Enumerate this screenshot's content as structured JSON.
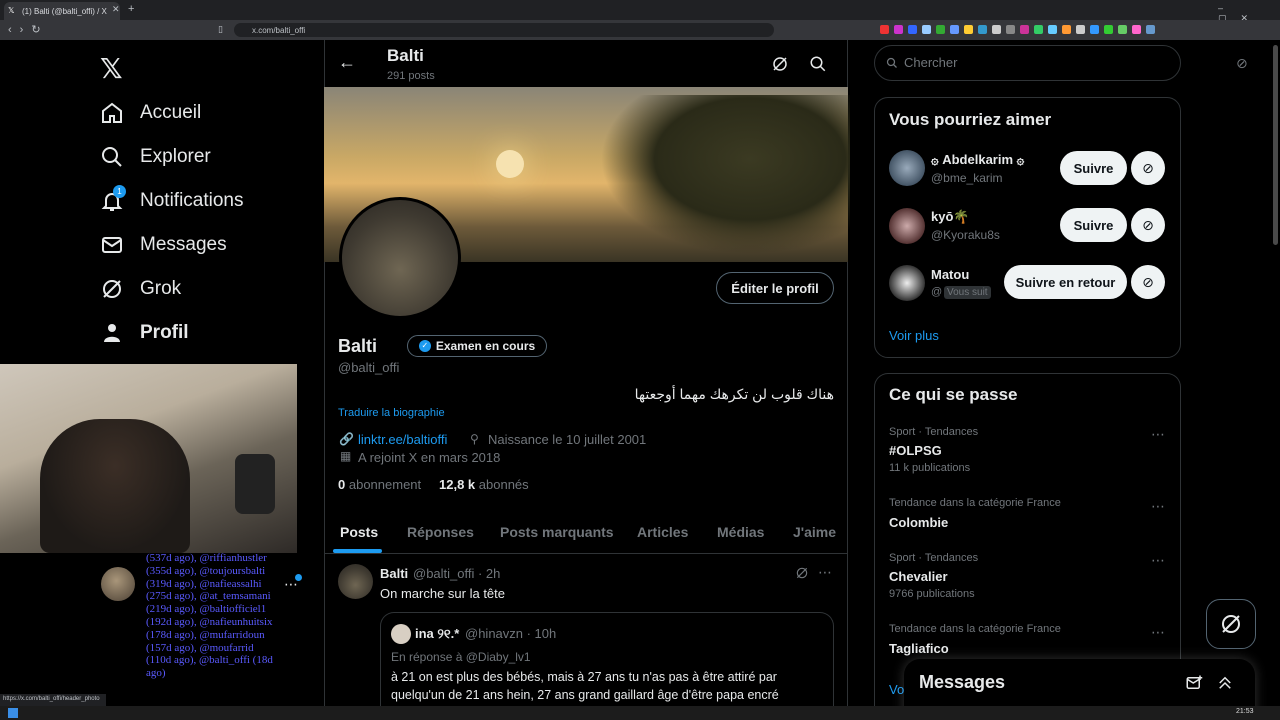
{
  "browser": {
    "tab_title": "(1) Balti (@balti_offi) / X",
    "url": "x.com/balti_offi",
    "status_url": "https://x.com/balti_offi/header_photo"
  },
  "sidebar": {
    "items": [
      {
        "label": "Accueil",
        "icon": "home-icon"
      },
      {
        "label": "Explorer",
        "icon": "search-icon"
      },
      {
        "label": "Notifications",
        "icon": "bell-icon",
        "badge": "1"
      },
      {
        "label": "Messages",
        "icon": "mail-icon"
      },
      {
        "label": "Grok",
        "icon": "grok-icon"
      },
      {
        "label": "Profil",
        "icon": "person-icon"
      }
    ]
  },
  "overlay_text": "(537d ago), @riffianhustler (355d ago), @toujoursbalti (319d ago), @nafieassalhi (275d ago), @at_temsamani (219d ago), @baltiofficiel1 (192d ago), @nafieunhuitsix (178d ago), @mufarridoun (157d ago), @moufarrid (110d ago), @balti_offi (18d ago)",
  "header": {
    "name": "Balti",
    "post_count": "291 posts"
  },
  "profile": {
    "edit_button": "Éditer le profil",
    "name": "Balti",
    "verification_badge": "Examen en cours",
    "handle": "@balti_offi",
    "bio": "هناك قلوب لن تكرهك مهما أوجعتها",
    "translate_link": "Traduire la biographie",
    "link": "linktr.ee/baltioffi",
    "birth": "Naissance le 10 juillet 2001",
    "joined": "A rejoint X en mars 2018",
    "following_count": "0",
    "following_label": "abonnement",
    "followers_count": "12,8 k",
    "followers_label": "abonnés"
  },
  "tabs": [
    "Posts",
    "Réponses",
    "Posts marquants",
    "Articles",
    "Médias",
    "J'aime"
  ],
  "post": {
    "author": "Balti",
    "handle_time": "@balti_offi · 2h",
    "text": "On marche sur la tête",
    "quote": {
      "author": "ina ୨୧.*",
      "handle_time": "@hinavzn · 10h",
      "reply_to": "En réponse à @Diaby_lv1",
      "text_line1": "à 21 on est plus des bébés, mais à 27 ans tu n'as pas à être attiré par",
      "text_line2": "quelqu'un de 21 ans hein, 27 ans grand gaillard âge d'être papa encré"
    }
  },
  "search": {
    "placeholder": "Chercher"
  },
  "suggestions": {
    "title": "Vous pourriez aimer",
    "people": [
      {
        "name": "۞ Abdelkarim ۞",
        "handle": "@bme_karim",
        "button": "Suivre"
      },
      {
        "name": "kyō🌴",
        "handle": "@Kyoraku8s",
        "button": "Suivre"
      },
      {
        "name": "Matou",
        "handle": "@",
        "follows_you": "Vous suit",
        "button": "Suivre en retour"
      }
    ],
    "more": "Voir plus"
  },
  "trends": {
    "title": "Ce qui se passe",
    "items": [
      {
        "meta": "Sport · Tendances",
        "title": "#OLPSG",
        "count": "11 k publications"
      },
      {
        "meta": "Tendance dans la catégorie France",
        "title": "Colombie",
        "count": ""
      },
      {
        "meta": "Sport · Tendances",
        "title": "Chevalier",
        "count": "9766 publications"
      },
      {
        "meta": "Tendance dans la catégorie France",
        "title": "Tagliafico",
        "count": ""
      }
    ],
    "more_partial": "Vo"
  },
  "messages_drawer": {
    "title": "Messages"
  },
  "taskbar": {
    "time": "21:53"
  }
}
